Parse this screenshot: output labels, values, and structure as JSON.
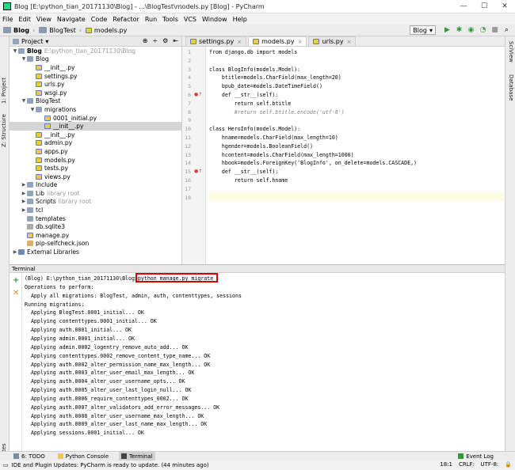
{
  "window": {
    "title": "Blog [E:\\python_tian_20171130\\Blog] - ...\\BlogTest\\models.py [Blog] - PyCharm",
    "controls": [
      "—",
      "☐",
      "✕"
    ]
  },
  "menu": [
    "File",
    "Edit",
    "View",
    "Navigate",
    "Code",
    "Refactor",
    "Run",
    "Tools",
    "VCS",
    "Window",
    "Help"
  ],
  "breadcrumb": [
    "Blog",
    "BlogTest",
    "models.py"
  ],
  "run_config": "Blog",
  "left_stripe": {
    "project": "1: Project",
    "structure": "Z: Structure",
    "favorites": "2: Favorites"
  },
  "right_stripe": {
    "sciview": "SciView",
    "database": "Database"
  },
  "project": {
    "header": "Project",
    "tree": [
      {
        "indent": 0,
        "arrow": "▼",
        "icon": "folder",
        "label": "Blog",
        "extra": "E:\\python_tian_20171130\\Blog",
        "bold": true
      },
      {
        "indent": 1,
        "arrow": "▼",
        "icon": "folder",
        "label": "Blog",
        "extra": ""
      },
      {
        "indent": 2,
        "arrow": "",
        "icon": "py",
        "label": "__init__.py",
        "extra": ""
      },
      {
        "indent": 2,
        "arrow": "",
        "icon": "py",
        "label": "settings.py",
        "extra": ""
      },
      {
        "indent": 2,
        "arrow": "",
        "icon": "py",
        "label": "urls.py",
        "extra": ""
      },
      {
        "indent": 2,
        "arrow": "",
        "icon": "py",
        "label": "wsgi.py",
        "extra": ""
      },
      {
        "indent": 1,
        "arrow": "▼",
        "icon": "folder",
        "label": "BlogTest",
        "extra": ""
      },
      {
        "indent": 2,
        "arrow": "▼",
        "icon": "folder",
        "label": "migrations",
        "extra": ""
      },
      {
        "indent": 3,
        "arrow": "",
        "icon": "py",
        "label": "0001_initial.py",
        "extra": ""
      },
      {
        "indent": 3,
        "arrow": "",
        "icon": "py",
        "label": "__init__.py",
        "extra": "",
        "selected": true
      },
      {
        "indent": 2,
        "arrow": "",
        "icon": "py",
        "label": "__init__.py",
        "extra": ""
      },
      {
        "indent": 2,
        "arrow": "",
        "icon": "py",
        "label": "admin.py",
        "extra": ""
      },
      {
        "indent": 2,
        "arrow": "",
        "icon": "py",
        "label": "apps.py",
        "extra": ""
      },
      {
        "indent": 2,
        "arrow": "",
        "icon": "py",
        "label": "models.py",
        "extra": ""
      },
      {
        "indent": 2,
        "arrow": "",
        "icon": "py",
        "label": "tests.py",
        "extra": ""
      },
      {
        "indent": 2,
        "arrow": "",
        "icon": "py",
        "label": "views.py",
        "extra": ""
      },
      {
        "indent": 1,
        "arrow": "▶",
        "icon": "folder",
        "label": "Include",
        "extra": ""
      },
      {
        "indent": 1,
        "arrow": "▶",
        "icon": "folder",
        "label": "Lib",
        "extra": "library root"
      },
      {
        "indent": 1,
        "arrow": "▶",
        "icon": "folder",
        "label": "Scripts",
        "extra": "library root"
      },
      {
        "indent": 1,
        "arrow": "▶",
        "icon": "folder",
        "label": "tcl",
        "extra": ""
      },
      {
        "indent": 1,
        "arrow": "",
        "icon": "folder",
        "label": "templates",
        "extra": ""
      },
      {
        "indent": 1,
        "arrow": "",
        "icon": "db",
        "label": "db.sqlite3",
        "extra": ""
      },
      {
        "indent": 1,
        "arrow": "",
        "icon": "py",
        "label": "manage.py",
        "extra": ""
      },
      {
        "indent": 1,
        "arrow": "",
        "icon": "json",
        "label": "pip-selfcheck.json",
        "extra": ""
      },
      {
        "indent": 0,
        "arrow": "▶",
        "icon": "lib",
        "label": "External Libraries",
        "extra": ""
      }
    ]
  },
  "editor": {
    "tabs": [
      {
        "label": "settings.py",
        "active": false
      },
      {
        "label": "models.py",
        "active": true
      },
      {
        "label": "urls.py",
        "active": false
      }
    ],
    "line_numbers": [
      "1",
      "2",
      "3",
      "4",
      "5",
      "6",
      "7",
      "8",
      "9",
      "10",
      "11",
      "12",
      "13",
      "14",
      "15",
      "16",
      "17",
      "18"
    ],
    "lines": [
      "from django.db import models",
      "",
      "class BlogInfo(models.Model):",
      "    btitle=models.CharField(max_length=20)",
      "    bpub_date=models.DateTimeField()",
      "    def __str__(self):",
      "        return self.btitle",
      "        #return self.btitle.encode('utf-8')",
      "",
      "class HeroInfo(models.Model):",
      "    hname=models.CharField(max_length=10)",
      "    hgender=models.BooleanField()",
      "    hcontent=models.CharField(max_length=1000)",
      "    hbook=models.ForeignKey('BlogInfo', on_delete=models.CASCADE,)",
      "    def __str__(self):",
      "        return self.hname",
      "",
      ""
    ]
  },
  "terminal": {
    "header": "Terminal",
    "prompt": "(Blog) E:\\python_tian_20171130\\Blog>",
    "command": "python manage.py migrate",
    "output": [
      "Operations to perform:",
      "  Apply all migrations: BlogTest, admin, auth, contenttypes, sessions",
      "Running migrations:",
      "  Applying BlogTest.0001_initial... OK",
      "  Applying contenttypes.0001_initial... OK",
      "  Applying auth.0001_initial... OK",
      "  Applying admin.0001_initial... OK",
      "  Applying admin.0002_logentry_remove_auto_add... OK",
      "  Applying contenttypes.0002_remove_content_type_name... OK",
      "  Applying auth.0002_alter_permission_name_max_length... OK",
      "  Applying auth.0003_alter_user_email_max_length... OK",
      "  Applying auth.0004_alter_user_username_opts... OK",
      "  Applying auth.0005_alter_user_last_login_null... OK",
      "  Applying auth.0006_require_contenttypes_0002... OK",
      "  Applying auth.0007_alter_validators_add_error_messages... OK",
      "  Applying auth.0008_alter_user_username_max_length... OK",
      "  Applying auth.0009_alter_user_last_name_max_length... OK",
      "  Applying sessions.0001_initial... OK"
    ]
  },
  "bottom_tabs": [
    {
      "label": "6: TODO",
      "active": false
    },
    {
      "label": "Python Console",
      "active": false
    },
    {
      "label": "Terminal",
      "active": true
    }
  ],
  "event_log": "Event Log",
  "status": {
    "message": "IDE and Plugin Updates: PyCharm is ready to update. (44 minutes ago)",
    "position": "18:1",
    "line_sep": "CRLF:",
    "encoding": "UTF-8:"
  },
  "colors": {
    "highlight_box": "#d40000",
    "selection": "#d5d5d5"
  }
}
